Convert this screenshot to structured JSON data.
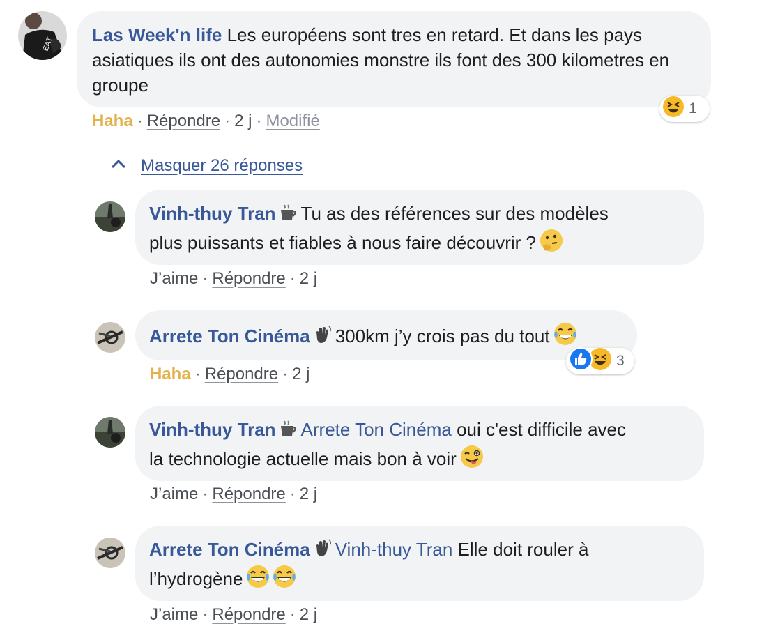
{
  "comments": [
    {
      "author": "Las Week'n life",
      "text": "Les européens sont tres en retard. Et dans les pays asiatiques ils ont des autonomies monstre ils font des 300 kilometres en groupe",
      "reaction_label": "Haha",
      "reply_label": "Répondre",
      "time": "2 j",
      "edited_label": "Modifié",
      "reaction_count": "1"
    }
  ],
  "replies_toggle": "Masquer 26 réponses",
  "replies": [
    {
      "author": "Vinh-thuy Tran",
      "text_line1": "Tu as des références sur des modèles",
      "text_line2": "plus puissants et fiables à nous faire découvrir ?",
      "like_label": "J’aime",
      "reply_label": "Répondre",
      "time": "2 j"
    },
    {
      "author": "Arrete Ton Cinéma",
      "text": "300km j’y crois pas du tout",
      "reaction_label": "Haha",
      "reply_label": "Répondre",
      "time": "2 j",
      "reaction_count": "3"
    },
    {
      "author": "Vinh-thuy Tran",
      "mention": "Arrete Ton Cinéma",
      "text_line1": "oui c'est difficile avec",
      "text_line2": "la technologie actuelle mais bon à voir",
      "like_label": "J’aime",
      "reply_label": "Répondre",
      "time": "2 j"
    },
    {
      "author": "Arrete Ton Cinéma",
      "mention": "Vinh-thuy Tran",
      "text_line1": "Elle doit rouler à",
      "text_line2": "l’hydrogène",
      "like_label": "J’aime",
      "reply_label": "Répondre",
      "time": "2 j"
    }
  ],
  "separator": "·",
  "icons": {
    "coffee_badge": "coffee-cup-icon",
    "waving_hand_badge": "waving-hand-icon",
    "thinking_emoji": "thinking-face-icon",
    "laughing_emoji": "tears-of-joy-icon",
    "winking_tongue_emoji": "winking-tongue-face-icon",
    "haha_reaction": "haha-reaction-icon",
    "like_reaction": "like-reaction-icon",
    "collapse": "chevron-up-icon"
  },
  "colors": {
    "author": "#385898",
    "bubble": "#f2f3f5",
    "haha": "#e3b24c",
    "meta": "#606770"
  }
}
